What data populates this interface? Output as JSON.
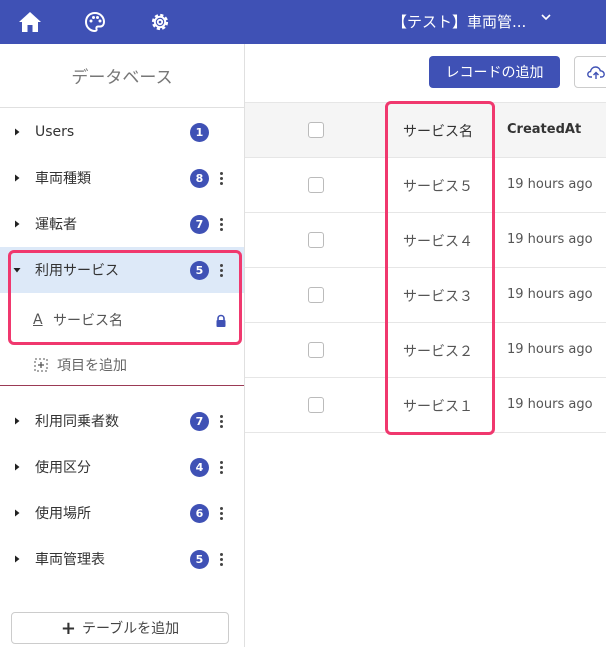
{
  "topbar": {
    "title": "【テスト】車両管..."
  },
  "sidebar": {
    "header": "データベース",
    "items": [
      {
        "label": "Users",
        "count": "1",
        "has_menu": false
      },
      {
        "label": "車両種類",
        "count": "8",
        "has_menu": true
      },
      {
        "label": "運転者",
        "count": "7",
        "has_menu": true
      },
      {
        "label": "利用サービス",
        "count": "5",
        "has_menu": true,
        "expanded": true
      },
      {
        "label": "利用同乗者数",
        "count": "7",
        "has_menu": true
      },
      {
        "label": "使用区分",
        "count": "4",
        "has_menu": true
      },
      {
        "label": "使用場所",
        "count": "6",
        "has_menu": true
      },
      {
        "label": "車両管理表",
        "count": "5",
        "has_menu": true
      }
    ],
    "field": {
      "type_icon": "A",
      "label": "サービス名"
    },
    "add_field_label": "項目を追加",
    "add_table_label": "テーブルを追加"
  },
  "main": {
    "add_record_label": "レコードの追加",
    "columns": {
      "name": "サービス名",
      "created": "CreatedAt"
    },
    "rows": [
      {
        "name": "サービス５",
        "created": "19 hours ago"
      },
      {
        "name": "サービス４",
        "created": "19 hours ago"
      },
      {
        "name": "サービス３",
        "created": "19 hours ago"
      },
      {
        "name": "サービス２",
        "created": "19 hours ago"
      },
      {
        "name": "サービス１",
        "created": "19 hours ago"
      }
    ]
  },
  "colors": {
    "primary": "#3f51b5",
    "selected_bg": "#dde9f8",
    "highlight": "#f0386e"
  }
}
